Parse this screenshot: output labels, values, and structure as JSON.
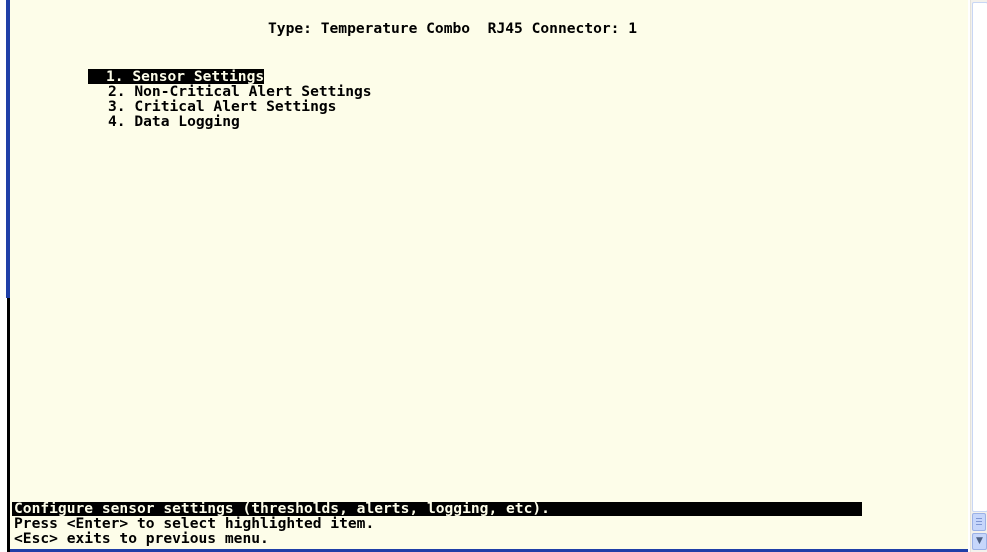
{
  "header": {
    "type_label": "Type: Temperature Combo",
    "connector_label": "RJ45 Connector: 1"
  },
  "menu": {
    "items": [
      {
        "label": "1. Sensor Settings",
        "selected": true
      },
      {
        "label": "2. Non-Critical Alert Settings",
        "selected": false
      },
      {
        "label": "3. Critical Alert Settings",
        "selected": false
      },
      {
        "label": "4. Data Logging",
        "selected": false
      }
    ]
  },
  "status": {
    "description": "Configure sensor settings (thresholds, alerts, logging, etc).",
    "hint_enter": "Press <Enter> to select highlighted item.",
    "hint_esc": "<Esc> exits to previous menu."
  },
  "scrollbar": {
    "down_icon": "chevron-down-icon",
    "grip_icon": "grip-icon"
  },
  "colors": {
    "terminal_bg": "#fdfde9",
    "text": "#000000",
    "highlight_bg": "#000000",
    "window_border": "#1f3fa8"
  }
}
